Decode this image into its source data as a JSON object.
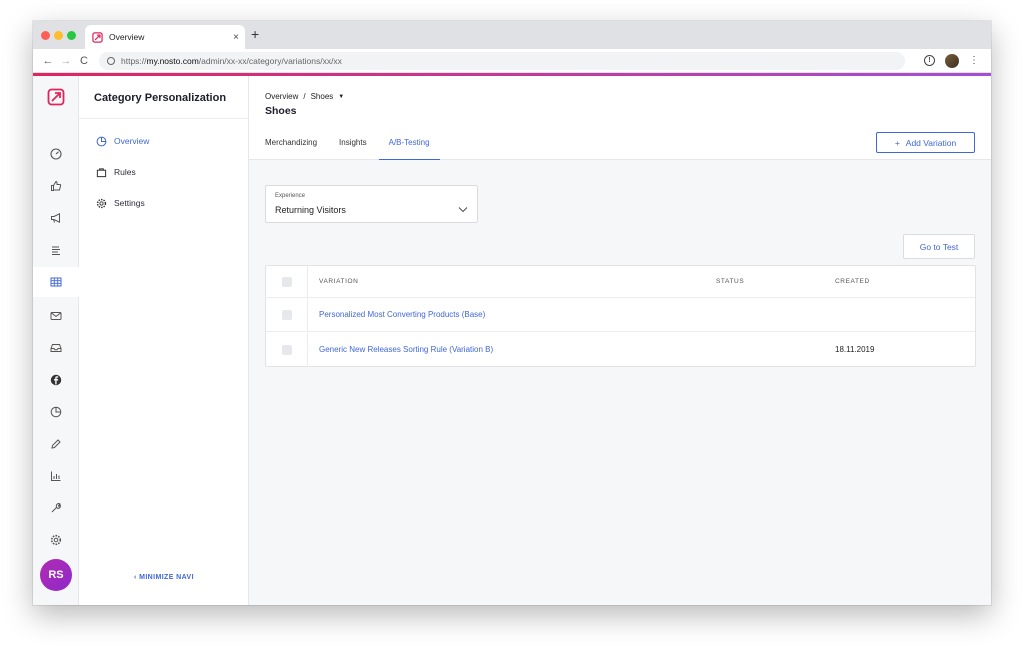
{
  "browser": {
    "tab_title": "Overview",
    "close_glyph": "×",
    "new_tab_glyph": "+",
    "back_glyph": "←",
    "forward_glyph": "→",
    "reload_glyph": "C",
    "url_prefix": "https://",
    "url_host": "my.nosto.com",
    "url_path": "/admin/xx-xx/category/variations/xx/xx",
    "menu_glyph": "⋮",
    "info_glyph": "!"
  },
  "rail": {
    "icons": [
      "dashboard-icon",
      "thumbs-up-icon",
      "megaphone-icon",
      "list-icon",
      "grid-icon",
      "mail-icon",
      "inbox-icon",
      "facebook-icon",
      "pie-chart-icon",
      "pen-icon",
      "bar-chart-icon",
      "wrench-icon",
      "gear-icon"
    ],
    "active_index": 4,
    "avatar_initials": "RS"
  },
  "subnav": {
    "title": "Category Personalization",
    "items": [
      {
        "label": "Overview",
        "icon": "pie-chart-icon"
      },
      {
        "label": "Rules",
        "icon": "bag-icon"
      },
      {
        "label": "Settings",
        "icon": "gear-icon"
      }
    ],
    "minimize_label": "MINIMIZE NAVI",
    "minimize_glyph": "‹"
  },
  "main": {
    "breadcrumb": {
      "root": "Overview",
      "sep": "/",
      "current": "Shoes",
      "caret": "▼"
    },
    "page_title": "Shoes",
    "tabs": [
      {
        "label": "Merchandizing"
      },
      {
        "label": "Insights"
      },
      {
        "label": "A/B-Testing"
      }
    ],
    "active_tab": 2,
    "add_button": {
      "plus": "+",
      "label": "Add Variation"
    },
    "experience_select": {
      "label": "Experience",
      "value": "Returning Visitors"
    },
    "goto_button": "Go to Test",
    "table": {
      "headers": {
        "variation": "VARIATION",
        "status": "STATUS",
        "created": "CREATED"
      },
      "rows": [
        {
          "variation": "Personalized Most Converting Products (Base)",
          "status": "",
          "created": ""
        },
        {
          "variation": "Generic New Releases Sorting Rule (Variation B)",
          "status": "",
          "created": "18.11.2019"
        }
      ]
    }
  },
  "colors": {
    "accent": "#3f67d8",
    "brand_pink": "#e0245e",
    "avatar": "#a02bbf"
  }
}
